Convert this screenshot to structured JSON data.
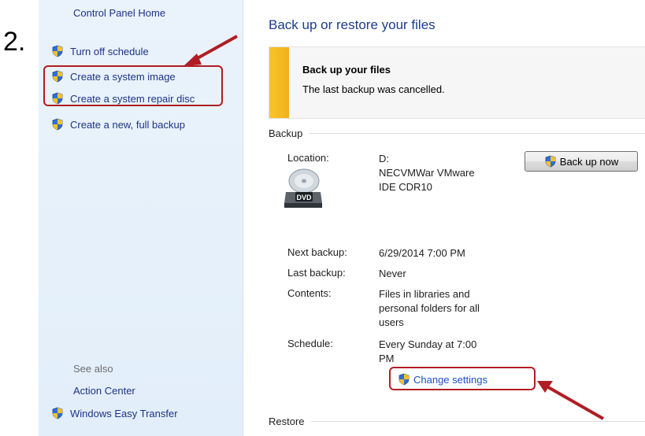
{
  "annotation": {
    "step_number": "2.",
    "accent_color": "#b01e23"
  },
  "sidebar": {
    "home_link": "Control Panel Home",
    "tasks": [
      {
        "label": "Turn off schedule"
      },
      {
        "label": "Create a system image"
      },
      {
        "label": "Create a system repair disc"
      },
      {
        "label": "Create a new, full backup"
      }
    ],
    "see_also_title": "See also",
    "see_also": [
      {
        "label": "Action Center"
      },
      {
        "label": "Windows Easy Transfer"
      }
    ]
  },
  "main": {
    "title": "Back up or restore your files",
    "banner": {
      "title": "Back up your files",
      "message": "The last backup was cancelled.",
      "color": "#f1b01c"
    },
    "backup_section": {
      "heading": "Backup",
      "location_label": "Location:",
      "location_value": "D:\nNECVMWar VMware\nIDE CDR10",
      "drive_icon": "dvd-drive-icon",
      "drive_badge": "DVD",
      "backup_button": "Back up now",
      "next_backup_label": "Next backup:",
      "next_backup_value": "6/29/2014 7:00 PM",
      "last_backup_label": "Last backup:",
      "last_backup_value": "Never",
      "contents_label": "Contents:",
      "contents_value": "Files in libraries and\npersonal folders for all\nusers",
      "schedule_label": "Schedule:",
      "schedule_value": "Every Sunday at 7:00\nPM",
      "change_settings": "Change settings"
    },
    "restore_section": {
      "heading": "Restore"
    }
  }
}
